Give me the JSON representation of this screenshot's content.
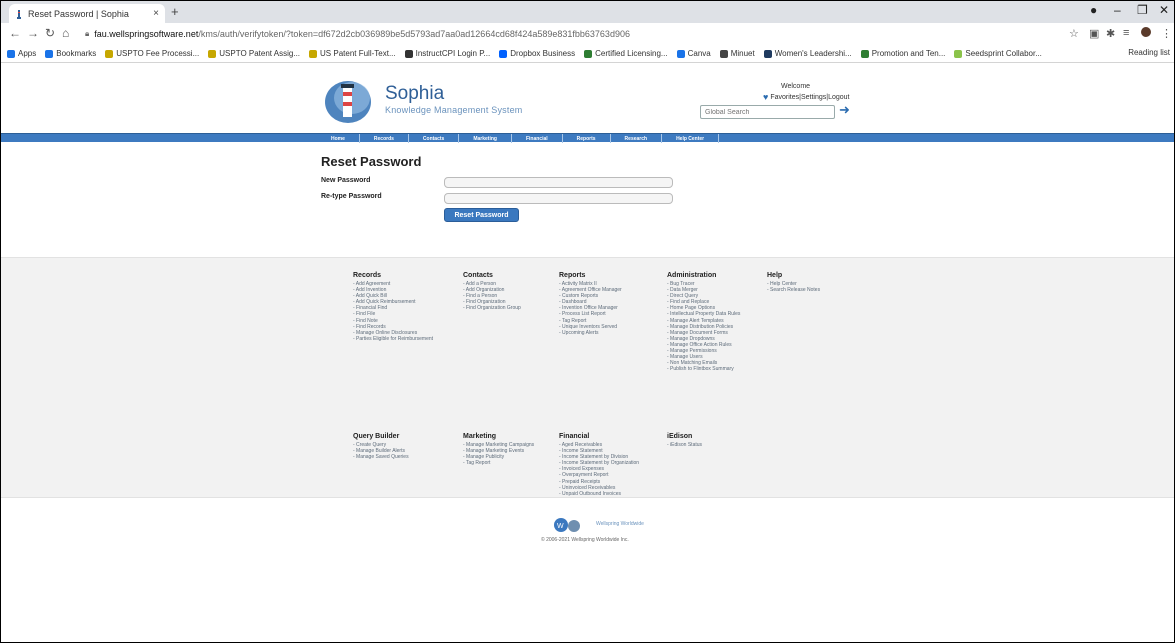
{
  "browser": {
    "tab_title": "Reset Password | Sophia",
    "tab_close": "×",
    "new_tab": "+",
    "url_host": "fau.wellspringsoftware.net",
    "url_path": "/kms/auth/verifytoken/?token=df672d2cb036989be5d5793ad7aa0ad12664cd68f424a589e831fbb63763d906",
    "bookmarks": [
      "Apps",
      "Bookmarks",
      "USPTO Fee Processi...",
      "USPTO Patent Assig...",
      "US Patent Full-Text...",
      "InstructCPI Login P...",
      "Dropbox Business",
      "Certified Licensing...",
      "Canva",
      "Minuet",
      "Women's Leadershi...",
      "Promotion and Ten...",
      "Seedsprint Collabor..."
    ],
    "bookmark_colors": [
      "#1a73e8",
      "#1a73e8",
      "#c6a700",
      "#c6a700",
      "#c6a700",
      "#333333",
      "#0061fe",
      "#2e7d32",
      "#1a73e8",
      "#444444",
      "#1f3a5f",
      "#2e7d32",
      "#8bc34a"
    ],
    "reading_list": "Reading list"
  },
  "header": {
    "brand": "Sophia",
    "tagline": "Knowledge Management System",
    "welcome": "Welcome",
    "favorites": "Favorites",
    "settings": "Settings",
    "logout": "Logout",
    "separator": " | ",
    "search_placeholder": "Global Search"
  },
  "nav": {
    "items": [
      "Home",
      "Records",
      "Contacts",
      "Marketing",
      "Financial",
      "Reports",
      "Research",
      "Help Center"
    ]
  },
  "form": {
    "title": "Reset Password",
    "new_password_label": "New Password",
    "retype_password_label": "Re-type Password",
    "new_password_value": "",
    "retype_password_value": "",
    "submit_label": "Reset Password"
  },
  "footer": {
    "columns": [
      {
        "heading": "Records",
        "items": [
          "- Add Agreement",
          "- Add Invention",
          "- Add Quick Bill",
          "- Add Quick Reimbursement",
          "- Financial Find",
          "- Find File",
          "- Find Note",
          "- Find Records",
          "- Manage Online Disclosures",
          "- Parties Eligible for Reimbursement"
        ]
      },
      {
        "heading": "Contacts",
        "items": [
          "- Add a Person",
          "- Add Organization",
          "- Find a Person",
          "- Find Organization",
          "- Find Organization Group"
        ]
      },
      {
        "heading": "Reports",
        "items": [
          "- Activity Matrix II",
          "- Agreement Office Manager",
          "- Custom Reports",
          "- Dashboard",
          "- Invention Office Manager",
          "- Process List Report",
          "- Tag Report",
          "- Unique Inventors Served",
          "- Upcoming Alerts"
        ]
      },
      {
        "heading": "Administration",
        "items": [
          "- Bug Tracer",
          "- Data Merger",
          "- Direct Query",
          "- Find and Replace",
          "- Home Page Options",
          "- Intellectual Property Data Rules",
          "- Manage Alert Templates",
          "- Manage Distribution Policies",
          "- Manage Document Forms",
          "- Manage Dropdowns",
          "- Manage Office Action Rules",
          "- Manage Permissions",
          "- Manage Users",
          "- Non Matching Emails",
          "- Publish to Flintbox Summary"
        ]
      },
      {
        "heading": "Help",
        "items": [
          "- Help Center",
          "- Search Release Notes"
        ]
      },
      {
        "heading": "Query Builder",
        "items": [
          "- Create Query",
          "- Manage Builder Alerts",
          "- Manage Saved Queries"
        ]
      },
      {
        "heading": "Marketing",
        "items": [
          "- Manage Marketing Campaigns",
          "- Manage Marketing Events",
          "- Manage Publicity",
          "- Tag Report"
        ]
      },
      {
        "heading": "Financial",
        "items": [
          "- Aged Receivables",
          "- Income Statement",
          "- Income Statement by Division",
          "- Income Statement by Organization",
          "- Invoiced Expenses",
          "- Overpayment Report",
          "- Prepaid Receipts",
          "- Uninvoiced Receivables",
          "- Unpaid Outbound Invoices"
        ]
      },
      {
        "heading": "iEdison",
        "items": [
          "- iEdison Status"
        ]
      }
    ]
  },
  "bottom": {
    "company": "Wellspring Worldwide",
    "copyright": "© 2006-2021 Wellspring Worldwide Inc."
  }
}
